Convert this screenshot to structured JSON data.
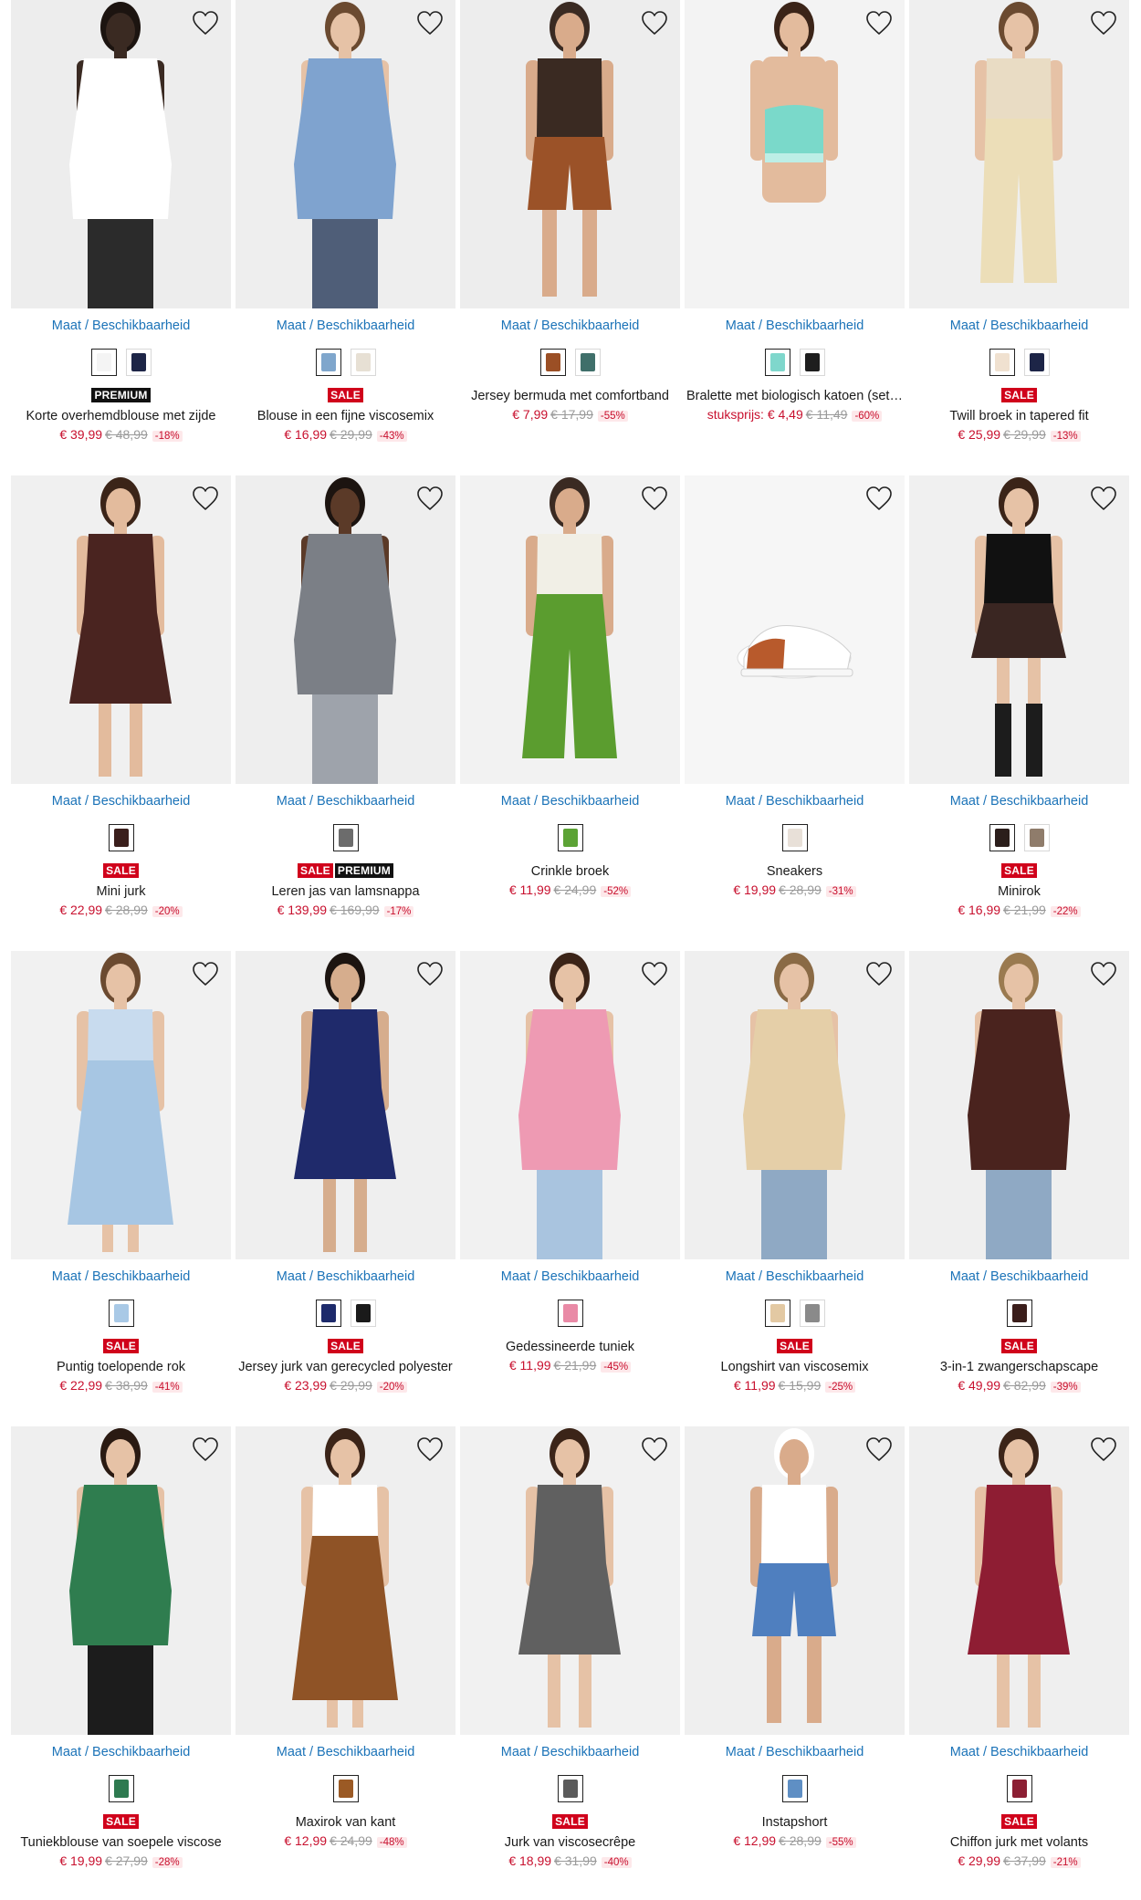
{
  "size_link_label": "Maat / Beschikbaarheid",
  "colors": {
    "sale": "#d0021b",
    "price": "#c8102e",
    "link": "#1b73b8",
    "premium": "#111111"
  },
  "products": [
    {
      "name": "Korte overhemdblouse met zijde",
      "price": "€ 39,99",
      "old_price": "€ 48,99",
      "discount": "-18%",
      "badges": [
        "PREMIUM"
      ],
      "swatches": [
        "#f4f4f4",
        "#1d2547"
      ],
      "img": {
        "bg": "#ededed",
        "top": "#ffffff",
        "bottom": "#2b2b2b",
        "skin": "#3a2a22",
        "hair": "#1c1410",
        "kind": "top"
      }
    },
    {
      "name": "Blouse in een fijne viscosemix",
      "price": "€ 16,99",
      "old_price": "€ 29,99",
      "discount": "-43%",
      "badges": [
        "SALE"
      ],
      "swatches": [
        "#7fa6cc",
        "#e7e0d4"
      ],
      "img": {
        "bg": "#eeeeee",
        "top": "#7fa3cf",
        "bottom": "#4f5e78",
        "skin": "#e6c2a6",
        "hair": "#6b4a30",
        "kind": "top"
      }
    },
    {
      "name": "Jersey bermuda met comfortband",
      "price": "€ 7,99",
      "old_price": "€ 17,99",
      "discount": "-55%",
      "badges": [],
      "swatches": [
        "#9b4f25",
        "#3f6f6a"
      ],
      "img": {
        "bg": "#ededed",
        "top": "#3a2a22",
        "bottom": "#9b5228",
        "skin": "#d9ab8b",
        "hair": "#3a2a22",
        "kind": "shorts"
      }
    },
    {
      "name": "Bralette met biologisch katoen (set…",
      "unit_label": "stuksprijs:",
      "price": "€ 4,49",
      "old_price": "€ 11,49",
      "discount": "-60%",
      "badges": [],
      "swatches": [
        "#7fd7cc",
        "#1e1e1e"
      ],
      "img": {
        "bg": "#f3f3f3",
        "top": "#7ad9ca",
        "bottom": "#e8d9cf",
        "skin": "#e3bb9d",
        "hair": "#3b2418",
        "kind": "bra"
      }
    },
    {
      "name": "Twill broek in tapered fit",
      "price": "€ 25,99",
      "old_price": "€ 29,99",
      "discount": "-13%",
      "badges": [
        "SALE"
      ],
      "swatches": [
        "#f0e1d0",
        "#1d2547"
      ],
      "img": {
        "bg": "#efefef",
        "top": "#e9dcc4",
        "bottom": "#ecdeb8",
        "skin": "#e6c2a6",
        "hair": "#6b4a30",
        "kind": "pants"
      }
    },
    {
      "name": "Mini jurk",
      "price": "€ 22,99",
      "old_price": "€ 28,99",
      "discount": "-20%",
      "badges": [
        "SALE"
      ],
      "swatches": [
        "#3b1f1c"
      ],
      "img": {
        "bg": "#f0f0f0",
        "top": "#4a2420",
        "bottom": "#4a2420",
        "skin": "#e3bb9d",
        "hair": "#3b2418",
        "kind": "dress"
      }
    },
    {
      "name": "Leren jas van lamsnappa",
      "price": "€ 139,99",
      "old_price": "€ 169,99",
      "discount": "-17%",
      "badges": [
        "SALE",
        "PREMIUM"
      ],
      "swatches": [
        "#6c6c6c"
      ],
      "img": {
        "bg": "#eeeeee",
        "top": "#7b7f86",
        "bottom": "#9ea3ab",
        "skin": "#5b3a28",
        "hair": "#1c1410",
        "kind": "top"
      }
    },
    {
      "name": "Crinkle broek",
      "price": "€ 11,99",
      "old_price": "€ 24,99",
      "discount": "-52%",
      "badges": [],
      "swatches": [
        "#5ca335"
      ],
      "img": {
        "bg": "#f2f2f2",
        "top": "#f1efe6",
        "bottom": "#5b9d2f",
        "skin": "#d9ab8b",
        "hair": "#3a2a22",
        "kind": "wide"
      }
    },
    {
      "name": "Sneakers",
      "price": "€ 19,99",
      "old_price": "€ 28,99",
      "discount": "-31%",
      "badges": [],
      "swatches": [
        "#e8e0d8"
      ],
      "img": {
        "bg": "#f6f6f6",
        "top": "#ffffff",
        "bottom": "#b85a2c",
        "skin": "#ffffff",
        "hair": "#ffffff",
        "kind": "shoe"
      }
    },
    {
      "name": "Minirok",
      "price": "€ 16,99",
      "old_price": "€ 21,99",
      "discount": "-22%",
      "badges": [
        "SALE"
      ],
      "swatches": [
        "#2b1e1b",
        "#8f7c6b"
      ],
      "img": {
        "bg": "#f0f0f0",
        "top": "#111111",
        "bottom": "#3a2622",
        "skin": "#e6c2a6",
        "hair": "#3b2418",
        "kind": "skirt"
      }
    },
    {
      "name": "Puntig toelopende rok",
      "price": "€ 22,99",
      "old_price": "€ 38,99",
      "discount": "-41%",
      "badges": [
        "SALE"
      ],
      "swatches": [
        "#a9c9e6"
      ],
      "img": {
        "bg": "#f1f1f1",
        "top": "#c8dbee",
        "bottom": "#a7c6e3",
        "skin": "#e6c2a6",
        "hair": "#6b4a30",
        "kind": "longskirt"
      }
    },
    {
      "name": "Jersey jurk van gerecycled polyester",
      "price": "€ 23,99",
      "old_price": "€ 29,99",
      "discount": "-20%",
      "badges": [
        "SALE"
      ],
      "swatches": [
        "#1d2a6b",
        "#1a1a1a"
      ],
      "img": {
        "bg": "#efefef",
        "top": "#1f2a6b",
        "bottom": "#1f2a6b",
        "skin": "#d6ad8d",
        "hair": "#1c1410",
        "kind": "dress"
      }
    },
    {
      "name": "Gedessineerde tuniek",
      "price": "€ 11,99",
      "old_price": "€ 21,99",
      "discount": "-45%",
      "badges": [],
      "swatches": [
        "#e98aa6"
      ],
      "img": {
        "bg": "#f1f1f1",
        "top": "#ee9ab3",
        "bottom": "#a9c4df",
        "skin": "#e6c2a6",
        "hair": "#3b2418",
        "kind": "top"
      }
    },
    {
      "name": "Longshirt van viscosemix",
      "price": "€ 11,99",
      "old_price": "€ 15,99",
      "discount": "-25%",
      "badges": [
        "SALE"
      ],
      "swatches": [
        "#e3c9a3",
        "#8a8a8a"
      ],
      "img": {
        "bg": "#efefef",
        "top": "#e5cfa8",
        "bottom": "#8fa9c4",
        "skin": "#e6c2a6",
        "hair": "#8a6a45",
        "kind": "top"
      }
    },
    {
      "name": "3-in-1 zwangerschapscape",
      "price": "€ 49,99",
      "old_price": "€ 82,99",
      "discount": "-39%",
      "badges": [
        "SALE"
      ],
      "swatches": [
        "#3b1e1b"
      ],
      "img": {
        "bg": "#efefef",
        "top": "#4a231e",
        "bottom": "#8fa9c4",
        "skin": "#e6c2a6",
        "hair": "#9a7a50",
        "kind": "top"
      }
    },
    {
      "name": "Tuniekblouse van soepele viscose",
      "price": "€ 19,99",
      "old_price": "€ 27,99",
      "discount": "-28%",
      "badges": [
        "SALE"
      ],
      "swatches": [
        "#2e7a50"
      ],
      "img": {
        "bg": "#efefef",
        "top": "#2f7d4f",
        "bottom": "#1c1c1c",
        "skin": "#e6c2a6",
        "hair": "#2a1a12",
        "kind": "top"
      }
    },
    {
      "name": "Maxirok van kant",
      "price": "€ 12,99",
      "old_price": "€ 24,99",
      "discount": "-48%",
      "badges": [],
      "swatches": [
        "#9b5a25"
      ],
      "img": {
        "bg": "#efefef",
        "top": "#ffffff",
        "bottom": "#8f5326",
        "skin": "#e6c2a6",
        "hair": "#3b2418",
        "kind": "longskirt"
      }
    },
    {
      "name": "Jurk van viscosecrêpe",
      "price": "€ 18,99",
      "old_price": "€ 31,99",
      "discount": "-40%",
      "badges": [
        "SALE"
      ],
      "swatches": [
        "#5b5b5b"
      ],
      "img": {
        "bg": "#f1f1f1",
        "top": "#606060",
        "bottom": "#606060",
        "skin": "#e6c2a6",
        "hair": "#3b2418",
        "kind": "dress"
      }
    },
    {
      "name": "Instapshort",
      "price": "€ 12,99",
      "old_price": "€ 28,99",
      "discount": "-55%",
      "badges": [],
      "swatches": [
        "#5f8fc4"
      ],
      "img": {
        "bg": "#efefef",
        "top": "#ffffff",
        "bottom": "#4f7fbf",
        "skin": "#d9ab8b",
        "hair": "#ffffff",
        "kind": "shorts"
      }
    },
    {
      "name": "Chiffon jurk met volants",
      "price": "€ 29,99",
      "old_price": "€ 37,99",
      "discount": "-21%",
      "badges": [
        "SALE"
      ],
      "swatches": [
        "#8c1f33"
      ],
      "img": {
        "bg": "#efefef",
        "top": "#8e1d33",
        "bottom": "#8e1d33",
        "skin": "#e6c2a6",
        "hair": "#3b2418",
        "kind": "dress"
      }
    }
  ]
}
